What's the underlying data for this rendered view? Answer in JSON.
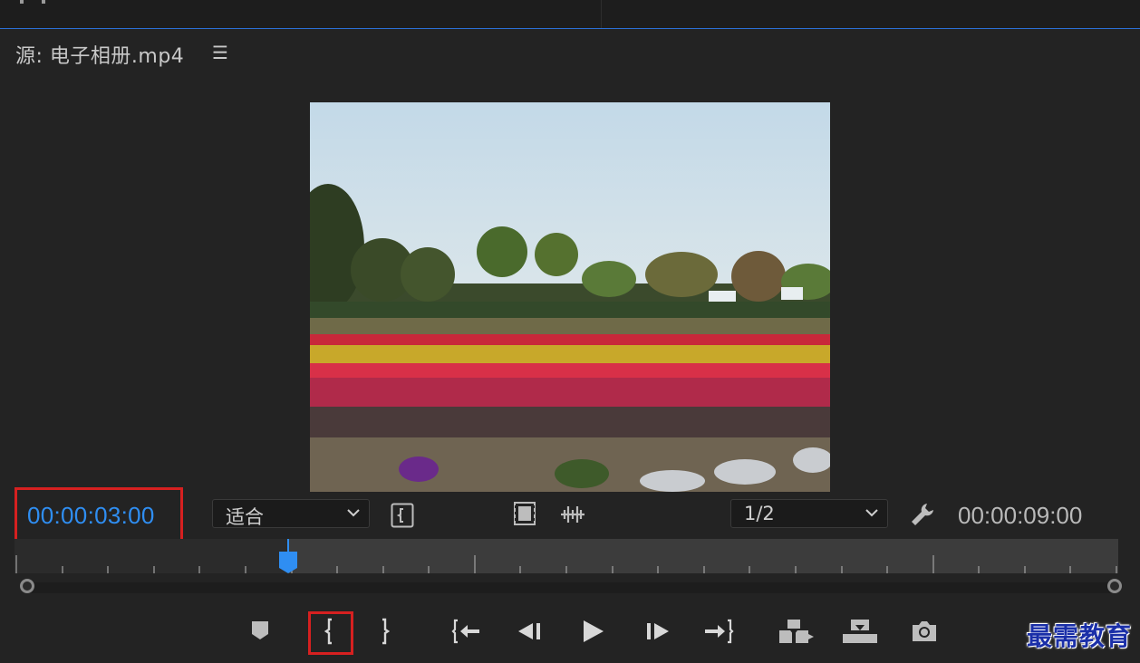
{
  "panel": {
    "title": "源: 电子相册.mp4",
    "menu_icon": "hamburger-menu-icon"
  },
  "monitor": {
    "current_timecode": "00:00:03:00",
    "duration_timecode": "00:00:09:00",
    "zoom": {
      "selected": "适合"
    },
    "resolution": {
      "selected": "1/2"
    },
    "playhead_position": 0.248
  },
  "controls": {
    "toolbar_icons": [
      "insert-edit-icon",
      "drag-video-only-icon",
      "drag-audio-only-icon",
      "wrench-icon"
    ],
    "transport_icons": [
      "add-marker-icon",
      "mark-in-icon",
      "mark-out-icon",
      "go-to-in-icon",
      "step-back-icon",
      "play-icon",
      "step-forward-icon",
      "go-to-out-icon",
      "insert-icon",
      "overwrite-icon",
      "export-frame-icon"
    ]
  },
  "watermark": {
    "text": "最需教育"
  },
  "colors": {
    "accent_timecode": "#2f8ef2",
    "highlight": "#d62020",
    "panel_bg": "#232323"
  }
}
